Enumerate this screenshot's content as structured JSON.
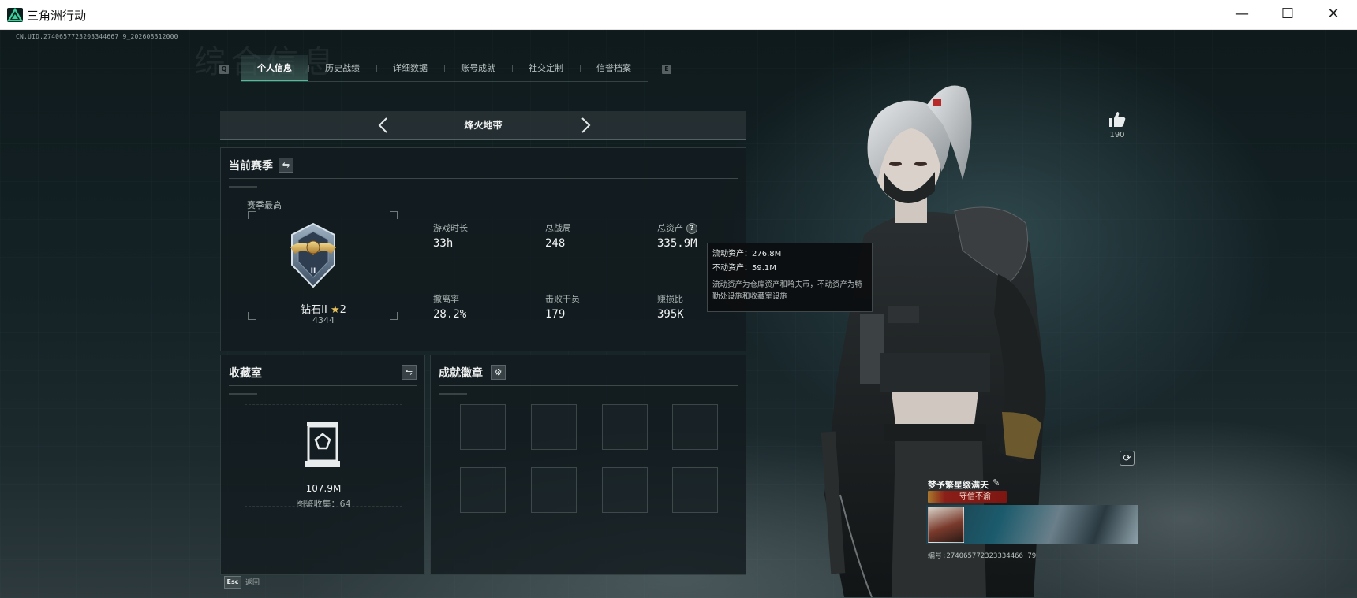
{
  "window": {
    "title": "三角洲行动",
    "minimize": "—",
    "maximize": "☐",
    "close": "✕"
  },
  "uid": "CN.UID.2740657723203344667 9_202608312000",
  "bg_title": "综合信息",
  "tabs": {
    "prev_key": "Q",
    "next_key": "E",
    "items": [
      "个人信息",
      "历史战绩",
      "详细数据",
      "账号成就",
      "社交定制",
      "信誉档案"
    ],
    "active": "个人信息"
  },
  "mode": {
    "label": "烽火地带"
  },
  "season": {
    "title": "当前赛季",
    "highest_label": "赛季最高",
    "rank_name": "钻石II",
    "rank_stars": "2",
    "rank_score": "4344",
    "stats": {
      "play_time": {
        "label": "游戏时长",
        "value": "33h"
      },
      "total_games": {
        "label": "总战局",
        "value": "248"
      },
      "total_assets": {
        "label": "总资产",
        "value": "335.9M"
      },
      "extraction_rate": {
        "label": "撤离率",
        "value": "28.2%"
      },
      "kills": {
        "label": "击败干员",
        "value": "179"
      },
      "profit_ratio": {
        "label": "赚损比",
        "value": "395K"
      }
    }
  },
  "tooltip": {
    "liquid": "流动资产：276.8M",
    "fixed": "不动资产：59.1M",
    "description": "流动资产为仓库资产和哈夫币，不动资产为特勤处设施和收藏室设施"
  },
  "collection": {
    "title": "收藏室",
    "value": "107.9M",
    "count_label": "图鉴收集：64"
  },
  "badges": {
    "title": "成就徽章"
  },
  "like": {
    "count": "190"
  },
  "player": {
    "name": "梦予繁星缀满天",
    "title": "守信不渝",
    "id": "编号:274065772323334466 79"
  },
  "bottom": {
    "esc_key": "Esc",
    "esc_label": "返回"
  },
  "colors": {
    "accent": "#49c09a",
    "panel": "#121b1e",
    "tooltip_bg": "#0c0e10",
    "title_badge": "#8a1e18"
  }
}
